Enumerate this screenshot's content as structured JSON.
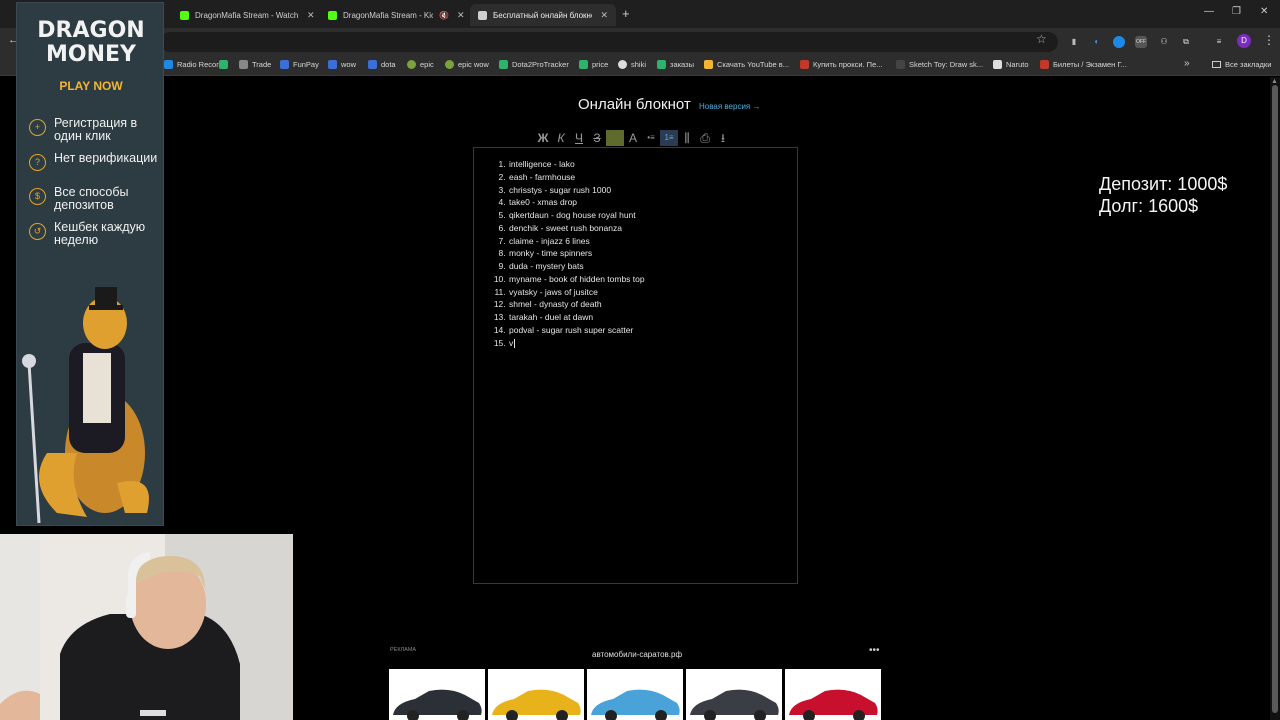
{
  "browser": {
    "tabs": [
      {
        "title": "DragonMafia Stream - Watch Li",
        "icon_color": "#53fc18",
        "active": false
      },
      {
        "title": "DragonMafia Stream - Kick",
        "icon_color": "#53fc18",
        "active": false
      },
      {
        "title": "Бесплатный онлайн блокнот д",
        "icon_color": "#cfcfcf",
        "active": true
      }
    ],
    "bookmarks": [
      {
        "label": "Radio Record",
        "icon_color": "#1e88e5"
      },
      {
        "label": "",
        "icon_color": "#2db36b"
      },
      {
        "label": "Trade",
        "icon_color": "#888888"
      },
      {
        "label": "FunPay",
        "icon_color": "#3b6fd8"
      },
      {
        "label": "wow",
        "icon_color": "#3b6fd8"
      },
      {
        "label": "dota",
        "icon_color": "#3b6fd8"
      },
      {
        "label": "epic",
        "icon_color": "#7aa33b"
      },
      {
        "label": "epic wow",
        "icon_color": "#7aa33b"
      },
      {
        "label": "Dota2ProTracker",
        "icon_color": "#2db36b"
      },
      {
        "label": "price",
        "icon_color": "#2db36b"
      },
      {
        "label": "shiki",
        "icon_color": "#dddddd"
      },
      {
        "label": "заказы",
        "icon_color": "#2db36b"
      },
      {
        "label": "Скачать YouTube в...",
        "icon_color": "#f2b632"
      },
      {
        "label": "Купить прокси. Пе...",
        "icon_color": "#c0392b"
      },
      {
        "label": "Sketch Toy: Draw sk...",
        "icon_color": "#444444"
      },
      {
        "label": "Naruto",
        "icon_color": "#dddddd"
      },
      {
        "label": "Билеты / Экзамен Г...",
        "icon_color": "#c0392b"
      }
    ],
    "all_bookmarks_label": "Все закладки",
    "profile_initial": "D"
  },
  "notepad": {
    "title": "Онлайн блокнот",
    "new_version_link": "Новая версия →",
    "toolbar": [
      "Ж",
      "К",
      "Ч",
      "З",
      "",
      "А",
      "•≡",
      "1≡",
      "⫼",
      "⎙",
      "⭳"
    ],
    "items": [
      "intelligence - lako",
      "eash - farmhouse",
      "chrisstys - sugar rush 1000",
      "take0 - xmas drop",
      "qikertdaun - dog house royal hunt",
      "denchik - sweet rush bonanza",
      "claime - injazz 6 lines",
      "monky - time spinners",
      "duda - mystery bats",
      "myname - book of hidden tombs top",
      "vyatsky - jaws of jusitce",
      "shmel - dynasty of death",
      "tarakah - duel at dawn",
      "podval - sugar rush super scatter",
      "v"
    ]
  },
  "overlay": {
    "deposit": "Депозит: 1000$",
    "debt": "Долг: 1600$"
  },
  "promo": {
    "brand_line1": "DRAGON",
    "brand_line2": "MONEY",
    "cta": "PLAY NOW",
    "features": [
      {
        "icon": "plus-icon",
        "text": "Регистрация в один клик"
      },
      {
        "icon": "question-icon",
        "text": "Нет верификации"
      },
      {
        "icon": "coin-icon",
        "text": "Все способы депозитов"
      },
      {
        "icon": "cashback-icon",
        "text": "Кешбек каждую неделю"
      }
    ]
  },
  "ad": {
    "label": "РЕКЛАМА",
    "domain": "автомобили-саратов.рф",
    "car_colors": [
      "#2b2f36",
      "#e8b21a",
      "#4aa3d8",
      "#3a3d44",
      "#c8102e"
    ]
  }
}
